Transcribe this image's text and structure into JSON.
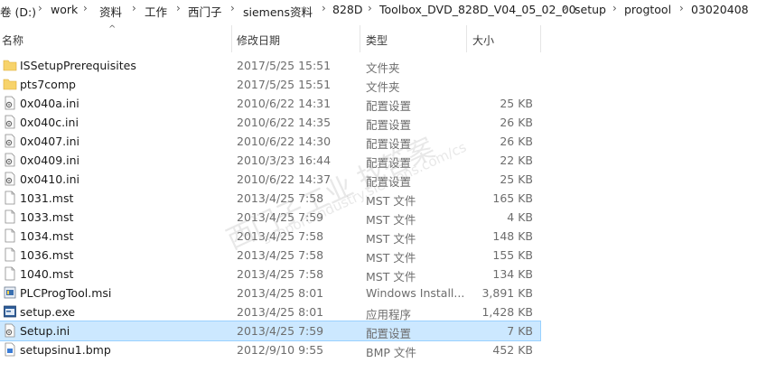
{
  "breadcrumb": [
    "卷 (D:)",
    "work",
    "资料",
    "工作",
    "西门子",
    "siemens资料",
    "828D",
    "Toolbox_DVD_828D_V04_05_02_00",
    "setup",
    "progtool",
    "03020408"
  ],
  "columns": {
    "name": "名称",
    "date": "修改日期",
    "type": "类型",
    "size": "大小"
  },
  "rows": [
    {
      "name": "ISSetupPrerequisites",
      "date": "2017/5/25 15:51",
      "type": "文件夹",
      "size": "",
      "icon": "folder-icon"
    },
    {
      "name": "pts7comp",
      "date": "2017/5/25 15:51",
      "type": "文件夹",
      "size": "",
      "icon": "folder-icon"
    },
    {
      "name": "0x040a.ini",
      "date": "2010/6/22 14:31",
      "type": "配置设置",
      "size": "25 KB",
      "icon": "ini-file-icon"
    },
    {
      "name": "0x040c.ini",
      "date": "2010/6/22 14:35",
      "type": "配置设置",
      "size": "26 KB",
      "icon": "ini-file-icon"
    },
    {
      "name": "0x0407.ini",
      "date": "2010/6/22 14:30",
      "type": "配置设置",
      "size": "26 KB",
      "icon": "ini-file-icon"
    },
    {
      "name": "0x0409.ini",
      "date": "2010/3/23 16:44",
      "type": "配置设置",
      "size": "22 KB",
      "icon": "ini-file-icon"
    },
    {
      "name": "0x0410.ini",
      "date": "2010/6/22 14:37",
      "type": "配置设置",
      "size": "25 KB",
      "icon": "ini-file-icon"
    },
    {
      "name": "1031.mst",
      "date": "2013/4/25 7:58",
      "type": "MST 文件",
      "size": "165 KB",
      "icon": "file-icon"
    },
    {
      "name": "1033.mst",
      "date": "2013/4/25 7:59",
      "type": "MST 文件",
      "size": "4 KB",
      "icon": "file-icon"
    },
    {
      "name": "1034.mst",
      "date": "2013/4/25 7:58",
      "type": "MST 文件",
      "size": "148 KB",
      "icon": "file-icon"
    },
    {
      "name": "1036.mst",
      "date": "2013/4/25 7:58",
      "type": "MST 文件",
      "size": "155 KB",
      "icon": "file-icon"
    },
    {
      "name": "1040.mst",
      "date": "2013/4/25 7:58",
      "type": "MST 文件",
      "size": "134 KB",
      "icon": "file-icon"
    },
    {
      "name": "PLCProgTool.msi",
      "date": "2013/4/25 8:01",
      "type": "Windows Install...",
      "size": "3,891 KB",
      "icon": "msi-file-icon"
    },
    {
      "name": "setup.exe",
      "date": "2013/4/25 8:01",
      "type": "应用程序",
      "size": "1,428 KB",
      "icon": "exe-file-icon"
    },
    {
      "name": "Setup.ini",
      "date": "2013/4/25 7:59",
      "type": "配置设置",
      "size": "7 KB",
      "icon": "ini-file-icon",
      "selected": true
    },
    {
      "name": "setupsinu1.bmp",
      "date": "2012/9/10 9:55",
      "type": "BMP 文件",
      "size": "452 KB",
      "icon": "bmp-file-icon"
    }
  ],
  "watermark": {
    "main": "西门子工业  找答案",
    "url": "support.industry.siemens.com/cs"
  },
  "colors": {
    "selected_bg": "#cce8ff",
    "folder": "#f7d36b",
    "header_text": "#3a3a3a",
    "secondary_text": "#6d6d6d"
  }
}
